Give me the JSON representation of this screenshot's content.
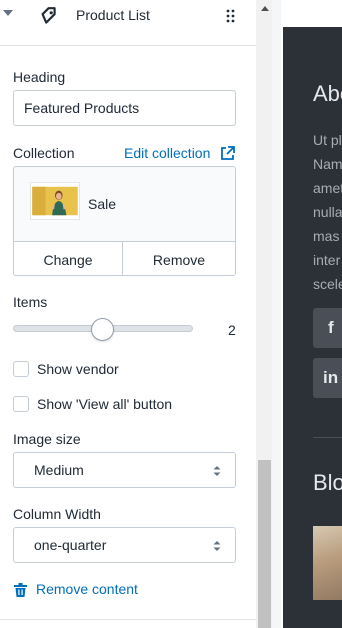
{
  "panel": {
    "title": "Product List",
    "icons": {
      "collapse": "caret-down-icon",
      "section": "tag-icon",
      "drag": "drag-handle-icon"
    }
  },
  "heading": {
    "label": "Heading",
    "value": "Featured Products"
  },
  "collection": {
    "label": "Collection",
    "edit_link": "Edit collection",
    "edit_icon": "external-link-icon",
    "selected_name": "Sale",
    "change_label": "Change",
    "remove_label": "Remove"
  },
  "items": {
    "label": "Items",
    "value": "2",
    "level": 0.5
  },
  "checkboxes": [
    {
      "label": "Show vendor",
      "checked": false
    },
    {
      "label": "Show 'View all' button",
      "checked": false
    }
  ],
  "image_size": {
    "label": "Image size",
    "value": "Medium"
  },
  "column_width": {
    "label": "Column Width",
    "value": "one-quarter"
  },
  "remove_content": {
    "label": "Remove content",
    "icon": "trash-icon"
  },
  "preview": {
    "heading": "Abo",
    "lines": [
      "Ut pl",
      "Nam",
      "amet",
      "nulla",
      "mas",
      "inter",
      "scele"
    ],
    "social": [
      {
        "icon": "facebook-icon",
        "glyph": "f"
      },
      {
        "icon": "linkedin-icon",
        "glyph": "in"
      }
    ],
    "heading2": "Blo"
  },
  "colors": {
    "link": "#006fbb",
    "text": "#212b36",
    "border": "#c4cdd5",
    "preview_dark": "#2c3037"
  }
}
